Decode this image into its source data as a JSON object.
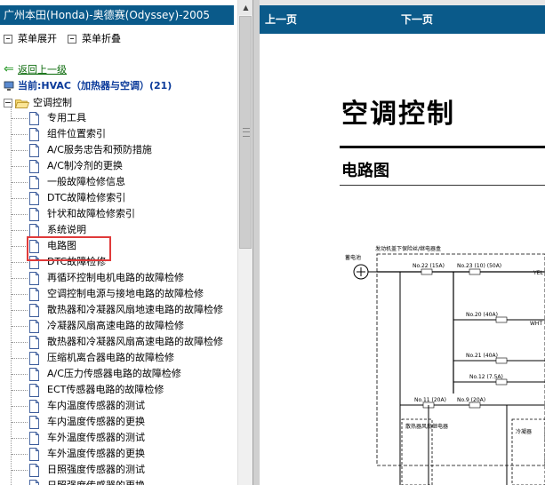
{
  "left_panel": {
    "title": "广州本田(Honda)-奥德赛(Odyssey)-2005",
    "expand_label": "菜单展开",
    "collapse_label": "菜单折叠",
    "back_label": "返回上一级",
    "current_label": "当前:HVAC（加热器与空调）(21)",
    "root_label": "空调控制",
    "items": [
      "专用工具",
      "组件位置索引",
      "A/C服务忠告和预防措施",
      "A/C制冷剂的更换",
      "一般故障检修信息",
      "DTC故障检修索引",
      "针状和故障检修索引",
      "系统说明",
      "电路图",
      "DTC故障检修",
      "再循环控制电机电路的故障检修",
      "空调控制电源与接地电路的故障检修",
      "散热器和冷凝器风扇地速电路的故障检修",
      "冷凝器风扇高速电路的故障检修",
      "散热器和冷凝器风扇高速电路的故障检修",
      "压缩机离合器电路的故障检修",
      "A/C压力传感器电路的故障检修",
      "ECT传感器电路的故障检修",
      "车内温度传感器的测试",
      "车内温度传感器的更换",
      "车外温度传感器的测试",
      "车外温度传感器的更换",
      "日照强度传感器的测试",
      "日照强度传感器的更换"
    ]
  },
  "right_panel": {
    "prev_label": "上一页",
    "next_label": "下一页",
    "doc_heading": "空调控制",
    "doc_subheading": "电路图",
    "diagram": {
      "header": "发动机盖下保险丝/继电器盒",
      "battery": "蓄电池",
      "fuses": [
        "No.22 (15A)",
        "No.23 (10) (50A)",
        "No.20 (40A)",
        "No.21 (40A)",
        "No.12 (7.5A)",
        "No.11 (20A)",
        "No.9 (20A)"
      ],
      "wire_yel": "YEL",
      "wire_wht": "WHT",
      "relay1": "散热器风扇继电器",
      "relay2": "冷凝器"
    }
  }
}
